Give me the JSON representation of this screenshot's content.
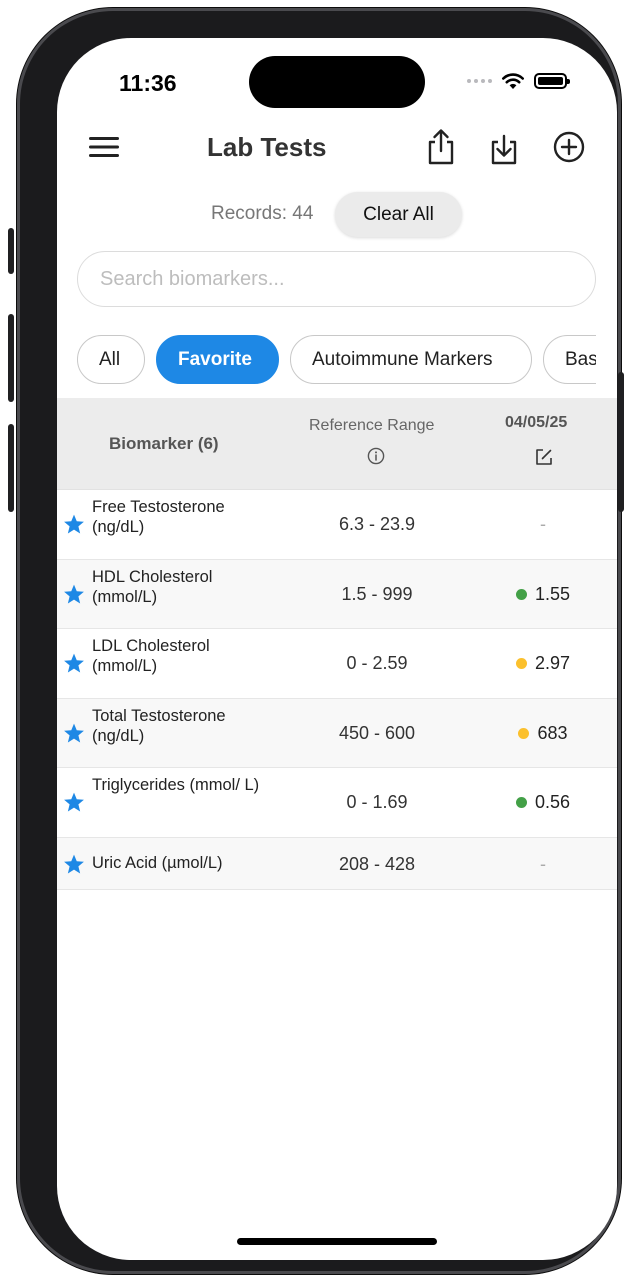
{
  "status": {
    "time": "11:36"
  },
  "nav": {
    "title": "Lab Tests"
  },
  "records": {
    "label": "Records: 44",
    "clear_label": "Clear All"
  },
  "search": {
    "placeholder": "Search biomarkers..."
  },
  "filters": [
    {
      "label": "All",
      "active": false
    },
    {
      "label": "Favorite",
      "active": true
    },
    {
      "label": "Autoimmune Markers",
      "active": false
    },
    {
      "label": "Bas",
      "active": false
    }
  ],
  "table": {
    "headers": {
      "biomarker": "Biomarker (6)",
      "reference": "Reference Range",
      "date": "04/05/25"
    },
    "rows": [
      {
        "name": "Free Testosterone (ng/dL)",
        "range": "6.3 - 23.9",
        "value": "-",
        "status": "none"
      },
      {
        "name": "HDL Cholesterol (mmol/L)",
        "range": "1.5 - 999",
        "value": "1.55",
        "status": "green"
      },
      {
        "name": "LDL Cholesterol (mmol/L)",
        "range": "0 - 2.59",
        "value": "2.97",
        "status": "yellow"
      },
      {
        "name": "Total Testosterone (ng/dL)",
        "range": "450 - 600",
        "value": "683",
        "status": "yellow"
      },
      {
        "name": "Triglycerides (mmol/ L)",
        "range": "0 - 1.69",
        "value": "0.56",
        "status": "green"
      },
      {
        "name": "Uric Acid (µmol/L)",
        "range": "208 - 428",
        "value": "-",
        "status": "none"
      }
    ]
  },
  "colors": {
    "accent": "#1e88e5",
    "green": "#43a047",
    "yellow": "#fbc02d",
    "star": "#1e88e5"
  }
}
